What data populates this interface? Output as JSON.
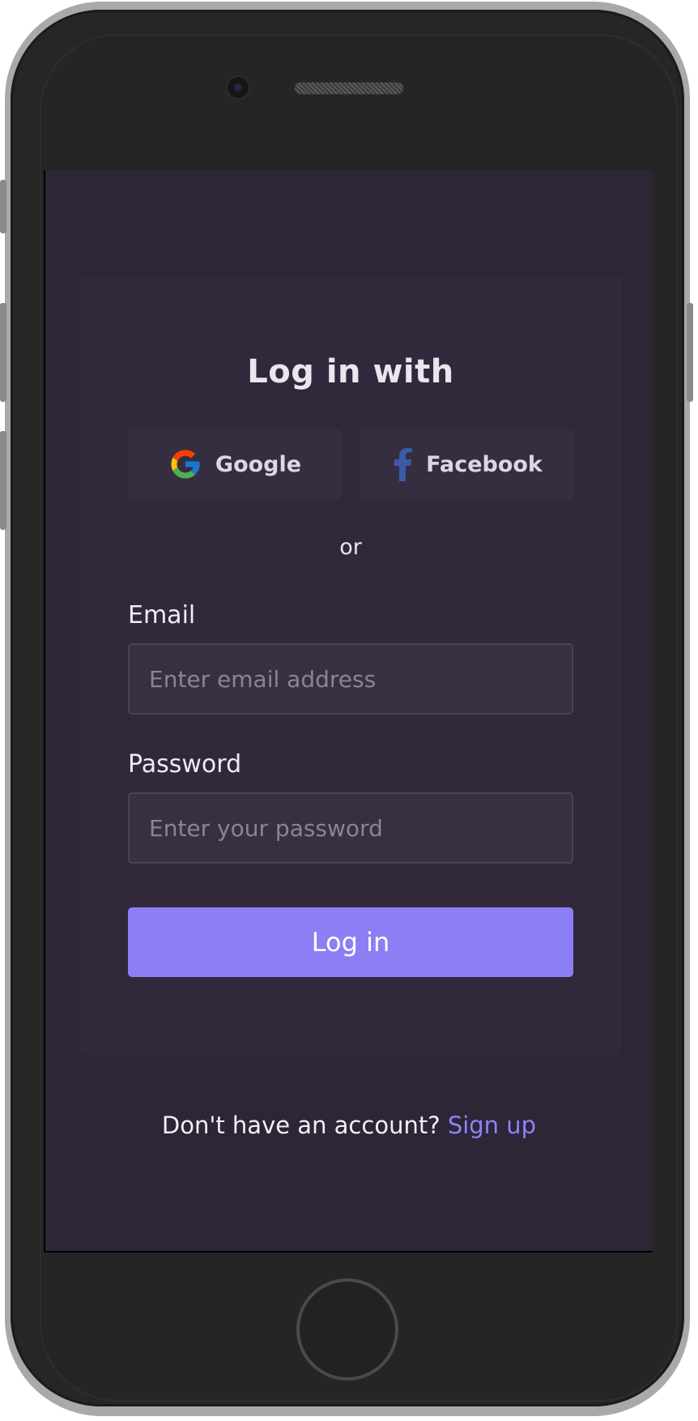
{
  "login": {
    "title": "Log in with",
    "social": {
      "google_label": "Google",
      "facebook_label": "Facebook"
    },
    "divider_text": "or",
    "email": {
      "label": "Email",
      "placeholder": "Enter email address",
      "value": ""
    },
    "password": {
      "label": "Password",
      "placeholder": "Enter your password",
      "value": ""
    },
    "submit_label": "Log in",
    "footer": {
      "prompt": "Don't have an account?",
      "link_label": "Sign up"
    }
  },
  "icons": {
    "google": "google-icon",
    "facebook": "facebook-icon"
  },
  "colors": {
    "accent": "#8c7ef4",
    "link": "#8f82f5",
    "screen_bg": "#2c2637",
    "card_bg": "#31293b"
  }
}
